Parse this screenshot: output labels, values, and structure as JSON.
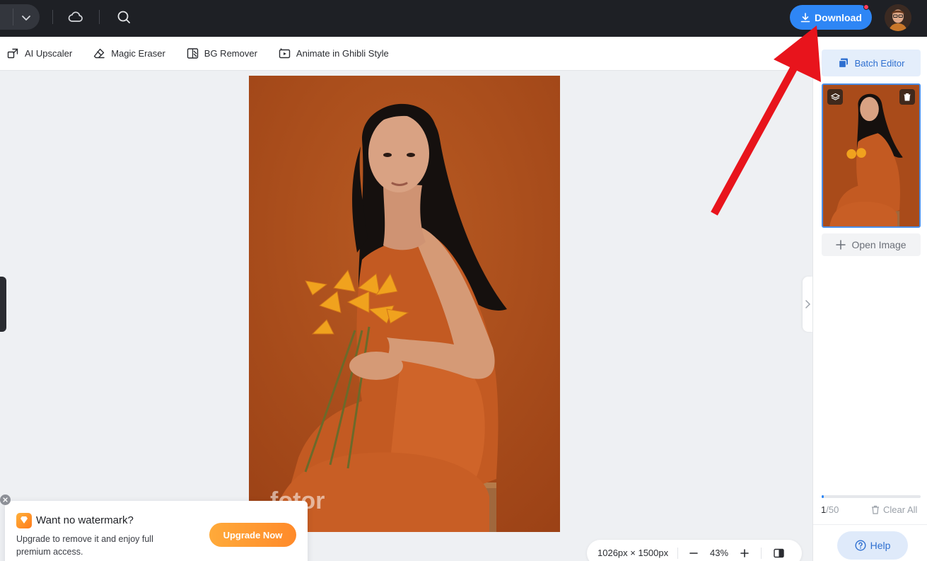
{
  "topbar": {
    "download_label": "Download",
    "icons": [
      "chevron-down-icon",
      "cloud-icon",
      "search-icon",
      "download-icon"
    ],
    "notification_dot_color": "#ff3b5c",
    "accent_color": "#2e86f5"
  },
  "tools": [
    {
      "label": "AI Upscaler",
      "icon": "upscale-icon"
    },
    {
      "label": "Magic Eraser",
      "icon": "eraser-icon"
    },
    {
      "label": "BG Remover",
      "icon": "bg-remover-icon"
    },
    {
      "label": "Animate in Ghibli Style",
      "icon": "animate-icon"
    }
  ],
  "canvas": {
    "watermark_text": "fotor",
    "image_dimensions": "1026px × 1500px",
    "zoom": "43%"
  },
  "right_panel": {
    "batch_editor_label": "Batch Editor",
    "open_image_label": "Open Image",
    "count_current": "1",
    "count_total": "/50",
    "progress_fraction": 0.02,
    "clear_all_label": "Clear All",
    "help_label": "Help"
  },
  "watermark_prompt": {
    "title": "Want no watermark?",
    "description": "Upgrade to remove it and enjoy full premium access.",
    "cta": "Upgrade Now"
  }
}
